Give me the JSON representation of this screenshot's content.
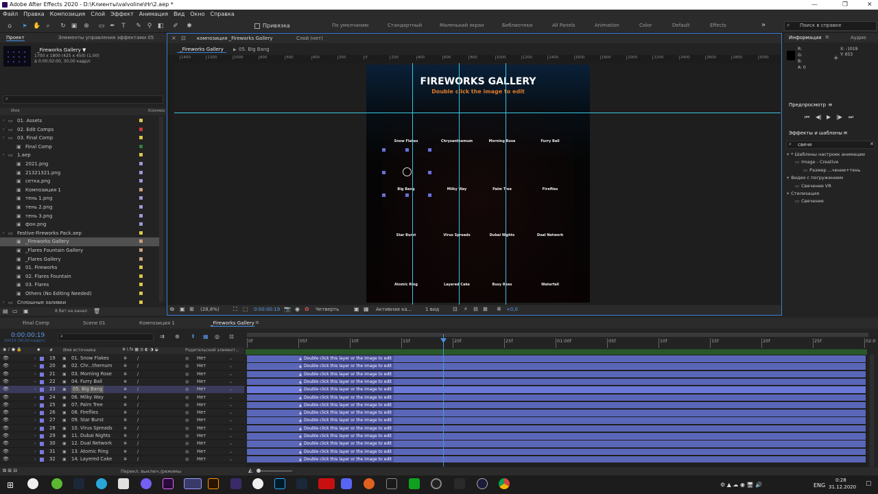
{
  "window": {
    "title": "Adobe After Effects 2020 - D:\\Клиенты\\valvoline\\Hr\\2.aep *"
  },
  "menu": [
    "Файл",
    "Правка",
    "Композиция",
    "Слой",
    "Эффект",
    "Анимация",
    "Вид",
    "Окно",
    "Справка"
  ],
  "toolbar": {
    "snap_label": "Привязка",
    "workspaces": [
      "По умолчанию",
      "Стандартный",
      "Маленький экран",
      "Библиотеки",
      "All Panels",
      "Animation",
      "Color",
      "Default",
      "Effects"
    ],
    "search_placeholder": "Поиск в справке"
  },
  "project": {
    "tab": "Проект",
    "effects_tab": "Элементы управления эффектами 05",
    "item_name": "_Fireworks Gallery ▼",
    "item_size": "1700 x 1800  (425 x 450) (1,00)",
    "item_duration": "Δ 0:00:02:00, 30,00 кадр/с",
    "col_name": "Имя",
    "col_comment": "Коммен",
    "footer_bits": "8 бит на канал",
    "items": [
      {
        "label": "01. Assets",
        "indent": 0,
        "color": "#d8c84a"
      },
      {
        "label": "02. Edit Comps",
        "indent": 0,
        "color": "#c83a3a"
      },
      {
        "label": "03. Final Comp",
        "indent": 0,
        "color": "#d8c84a"
      },
      {
        "label": "Final Comp",
        "indent": 1,
        "color": "#3a7a3a"
      },
      {
        "label": "1.aep",
        "indent": 0,
        "color": "#d8c84a"
      },
      {
        "label": "2021.png",
        "indent": 1,
        "color": "#9a9ad8"
      },
      {
        "label": "21321321.png",
        "indent": 1,
        "color": "#9a9ad8"
      },
      {
        "label": "сетка.png",
        "indent": 1,
        "color": "#9a9ad8"
      },
      {
        "label": "Композиция 1",
        "indent": 1,
        "color": "#c8a080"
      },
      {
        "label": "тень 1.png",
        "indent": 1,
        "color": "#9a9ad8"
      },
      {
        "label": "тень 2.png",
        "indent": 1,
        "color": "#9a9ad8"
      },
      {
        "label": "тень 3.png",
        "indent": 1,
        "color": "#9a9ad8"
      },
      {
        "label": "фон.png",
        "indent": 1,
        "color": "#9a9ad8"
      },
      {
        "label": "Festive-Fireworks Pack.aep",
        "indent": 0,
        "color": "#d8c84a"
      },
      {
        "label": "_Fireworks Gallery",
        "indent": 1,
        "color": "#c8a080",
        "selected": true
      },
      {
        "label": "_Flares Fountain Gallery",
        "indent": 1,
        "color": "#c8a080"
      },
      {
        "label": "_Flares Gallery",
        "indent": 1,
        "color": "#c8a080"
      },
      {
        "label": "01. Fireworks",
        "indent": 1,
        "color": "#d8c84a"
      },
      {
        "label": "02. Flares Fountain",
        "indent": 1,
        "color": "#d8c84a"
      },
      {
        "label": "03. Flares",
        "indent": 1,
        "color": "#d8c84a"
      },
      {
        "label": "Others (No Editing Needed)",
        "indent": 1,
        "color": "#d8c84a"
      },
      {
        "label": "Сплошные заливки",
        "indent": 0,
        "color": "#d8c84a"
      }
    ]
  },
  "comp_viewer": {
    "tab": "композиция _Fireworks Gallery",
    "layer_tab": "Слой (нет)",
    "breadcrumb1": "_Fireworks Gallery",
    "breadcrumb2": "05. Big Bang",
    "ruler": [
      "1400",
      "1200",
      "1000",
      "800",
      "600",
      "400",
      "200",
      "0",
      "200",
      "400",
      "600",
      "800",
      "1000",
      "1200",
      "1400",
      "1600",
      "1800",
      "2000",
      "2200",
      "2400",
      "2600",
      "2800",
      "3000"
    ],
    "zoom": "(28,8%)",
    "time": "0:00:00:19",
    "resolution": "Четверть",
    "camera": "Активная ка...",
    "views": "1 вид",
    "exposure": "+0,0"
  },
  "canvas": {
    "title": "FIREWORKS GALLERY",
    "subtitle": "Double click the image to edit",
    "labels": [
      [
        "Snow Flakes",
        "Chrysanthemum",
        "Morning Rose",
        "Furry Ball"
      ],
      [
        "Big Bang",
        "Milky Way",
        "Palm Tree",
        "Fireflies"
      ],
      [
        "Star Burst",
        "Virus Spreads",
        "Dubai Nights",
        "Dual Network"
      ],
      [
        "Atomic Ring",
        "Layered Cake",
        "Busy Bees",
        "Waterfall"
      ]
    ]
  },
  "info": {
    "tab": "Информация",
    "audio_tab": "Аудио",
    "r": "R:",
    "g": "G:",
    "b": "B:",
    "a": "A:  0",
    "x": "X:  -1019",
    "y": "Y:  653"
  },
  "preview": {
    "title": "Предпросмотр"
  },
  "effects": {
    "title": "Эффекты и шаблоны",
    "search": "свече",
    "tree": [
      {
        "label": "* Шаблоны настроек анимации",
        "indent": 0
      },
      {
        "label": "Image - Creative",
        "indent": 1
      },
      {
        "label": "Размер ...чение+тень",
        "indent": 2
      },
      {
        "label": "Видео с погружением",
        "indent": 0
      },
      {
        "label": "Свечение VR",
        "indent": 1
      },
      {
        "label": "Стилизация",
        "indent": 0
      },
      {
        "label": "Свечение",
        "indent": 1
      }
    ]
  },
  "timeline": {
    "tabs": [
      "Final Comp",
      "Scene 01",
      "Композиция 1",
      "_Fireworks Gallery"
    ],
    "time": "0:00:00:19",
    "fps": "00019 (30,00 кадр/с)",
    "col_source": "Имя источника",
    "col_parent": "Родительский элемент...",
    "ruler": [
      "0f",
      "05f",
      "10f",
      "15f",
      "20f",
      "25f",
      "01:00f",
      "05f",
      "10f",
      "15f",
      "20f",
      "25f",
      "02:0"
    ],
    "footer": "Перекл. выключ./режимы",
    "bar_text": "Double click this layer or the image to edit",
    "layers": [
      {
        "num": "19",
        "name": "01. Snow Flakes",
        "parent": "Нет"
      },
      {
        "num": "20",
        "name": "02. Chr...themum",
        "parent": "Нет"
      },
      {
        "num": "21",
        "name": "03. Morning Rose",
        "parent": "Нет"
      },
      {
        "num": "22",
        "name": "04. Furry Ball",
        "parent": "Нет"
      },
      {
        "num": "23",
        "name": "05. Big Bang",
        "parent": "Нет",
        "selected": true
      },
      {
        "num": "24",
        "name": "06. Milky Way",
        "parent": "Нет"
      },
      {
        "num": "25",
        "name": "07. Palm Tree",
        "parent": "Нет"
      },
      {
        "num": "26",
        "name": "08. Fireflies",
        "parent": "Нет"
      },
      {
        "num": "27",
        "name": "09. Star Burst",
        "parent": "Нет"
      },
      {
        "num": "28",
        "name": "10. Virus Spreads",
        "parent": "Нет"
      },
      {
        "num": "29",
        "name": "11. Dubai Nights",
        "parent": "Нет"
      },
      {
        "num": "30",
        "name": "12. Dual Network",
        "parent": "Нет"
      },
      {
        "num": "31",
        "name": "13. Atomic Ring",
        "parent": "Нет"
      },
      {
        "num": "32",
        "name": "14. Layered Cake",
        "parent": "Нет"
      }
    ]
  },
  "taskbar": {
    "lang": "ENG",
    "time": "0:28",
    "date": "31.12.2020"
  }
}
